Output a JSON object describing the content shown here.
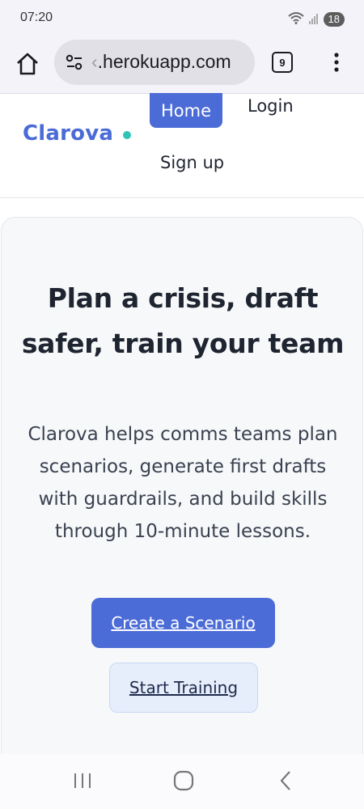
{
  "status_bar": {
    "time": "07:20",
    "battery": "18"
  },
  "browser": {
    "url_faded": "‹",
    "url": ".herokuapp.com",
    "tab_count": "9"
  },
  "header": {
    "logo": "Clarova",
    "nav": {
      "home": "Home",
      "login": "Login",
      "signup": "Sign up"
    }
  },
  "hero": {
    "title": "Plan a crisis, draft safer, train your team",
    "subtitle": "Clarova helps comms teams plan scenarios, generate first drafts with guardrails, and build skills through 10-minute lessons.",
    "primary_cta": "Create a Scenario",
    "secondary_cta": "Start Training"
  },
  "colors": {
    "brand": "#4b6bd6",
    "accent_dot": "#2ec4b6",
    "secondary_button_bg": "#e6eefc"
  }
}
